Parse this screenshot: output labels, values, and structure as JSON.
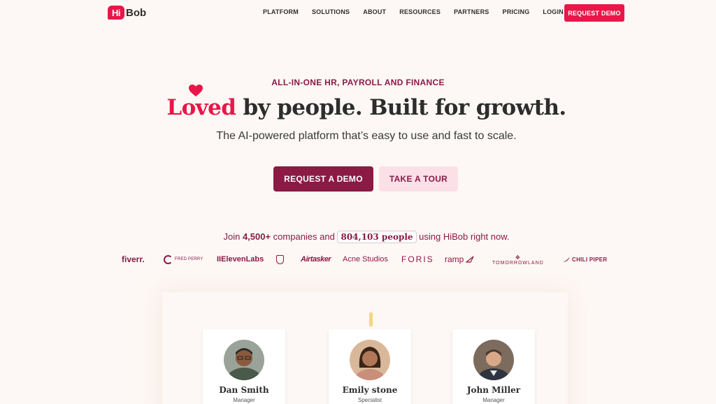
{
  "nav": {
    "logo_badge": "Hi",
    "logo_text": "Bob",
    "links": [
      "PLATFORM",
      "SOLUTIONS",
      "ABOUT",
      "RESOURCES",
      "PARTNERS",
      "PRICING",
      "LOGIN"
    ],
    "cta": "REQUEST DEMO"
  },
  "hero": {
    "eyebrow": "ALL-IN-ONE HR, PAYROLL AND FINANCE",
    "headline_accent": "Loved",
    "headline_rest": " by people. Built for growth.",
    "subline": "The AI-powered platform that’s easy to use and fast to scale.",
    "primary_button": "REQUEST A DEMO",
    "secondary_button": "TAKE A TOUR"
  },
  "proof": {
    "prefix": "Join ",
    "companies": "4,500+",
    "middle": " companies and ",
    "people_count": "804,103 people",
    "suffix": " using HiBob right now."
  },
  "logos": {
    "fiverr": "fiverr.",
    "fredperry": "FRED PERRY",
    "elevenlabs": "IIElevenLabs",
    "airtasker": "Airtasker",
    "acne": "Acne Studios",
    "foris": "FORIS",
    "ramp": "ramp",
    "tomorrowland": "TOMORROWLAND",
    "chilipiper": "CHILI PIPER"
  },
  "people": [
    {
      "name": "Dan Smith",
      "role": "Manager"
    },
    {
      "name": "Emily stone",
      "role": "Specialist"
    },
    {
      "name": "John Miller",
      "role": "Manager"
    }
  ],
  "colors": {
    "accent": "#e8174a",
    "brand": "#8b1a45",
    "background": "#fdf8f5",
    "secondary_button_bg": "#fbe0e8"
  }
}
